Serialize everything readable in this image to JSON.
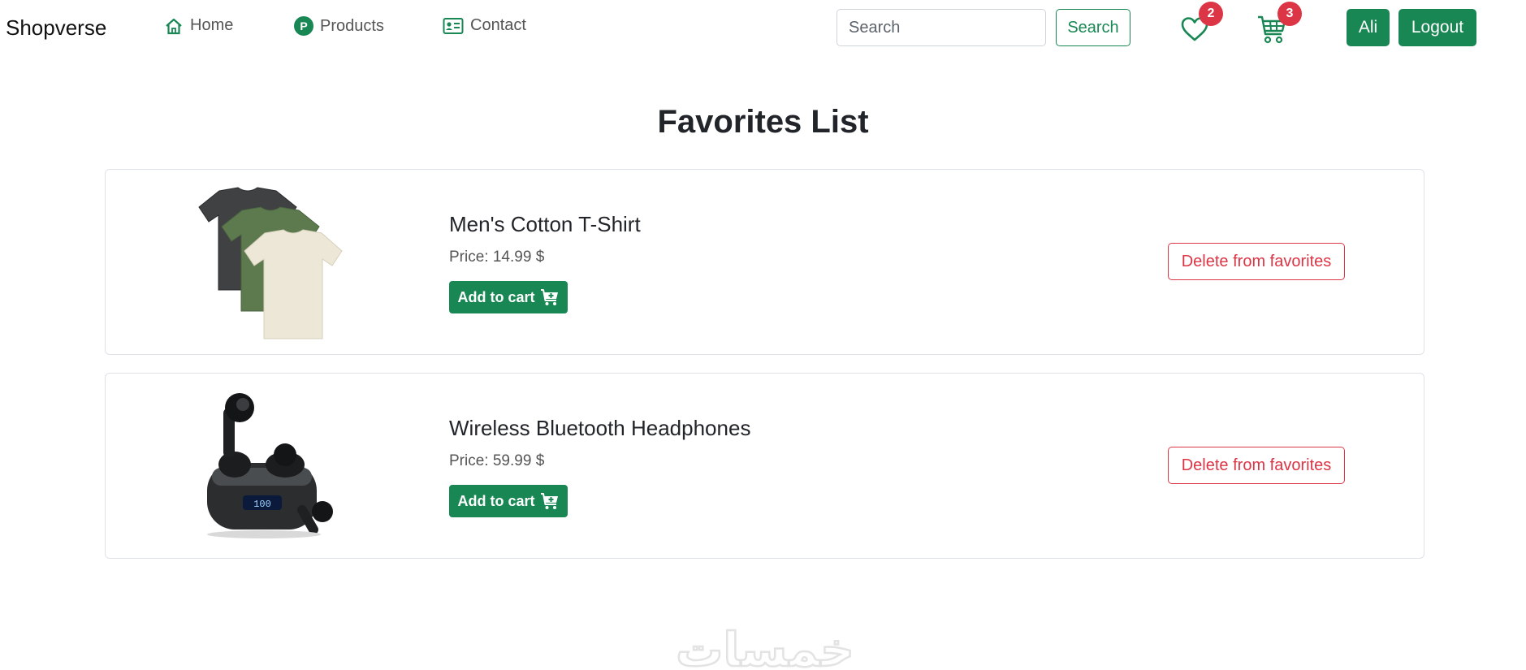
{
  "navbar": {
    "brand": "Shopverse",
    "links": [
      {
        "label": "Home",
        "icon": "home-icon"
      },
      {
        "label": "Products",
        "icon": "products-p-icon"
      },
      {
        "label": "Contact",
        "icon": "contact-card-icon"
      }
    ],
    "search": {
      "placeholder": "Search",
      "value": "",
      "button_label": "Search"
    },
    "favorites": {
      "icon": "heart-icon",
      "count": "2"
    },
    "cart": {
      "icon": "cart-icon",
      "count": "3"
    },
    "user_button": "Ali",
    "logout_button": "Logout"
  },
  "page": {
    "title": "Favorites List"
  },
  "favorites": [
    {
      "name": "Men's Cotton T-Shirt",
      "price_label": "Price:",
      "price": "14.99",
      "currency": "$",
      "add_to_cart_label": "Add to cart",
      "delete_label": "Delete from favorites"
    },
    {
      "name": "Wireless Bluetooth Headphones",
      "price_label": "Price:",
      "price": "59.99",
      "currency": "$",
      "add_to_cart_label": "Add to cart",
      "delete_label": "Delete from favorites"
    }
  ],
  "colors": {
    "primary_green": "#198754",
    "danger_red": "#dc3545",
    "border_gray": "#dee2e6"
  },
  "watermark": "خمسات"
}
